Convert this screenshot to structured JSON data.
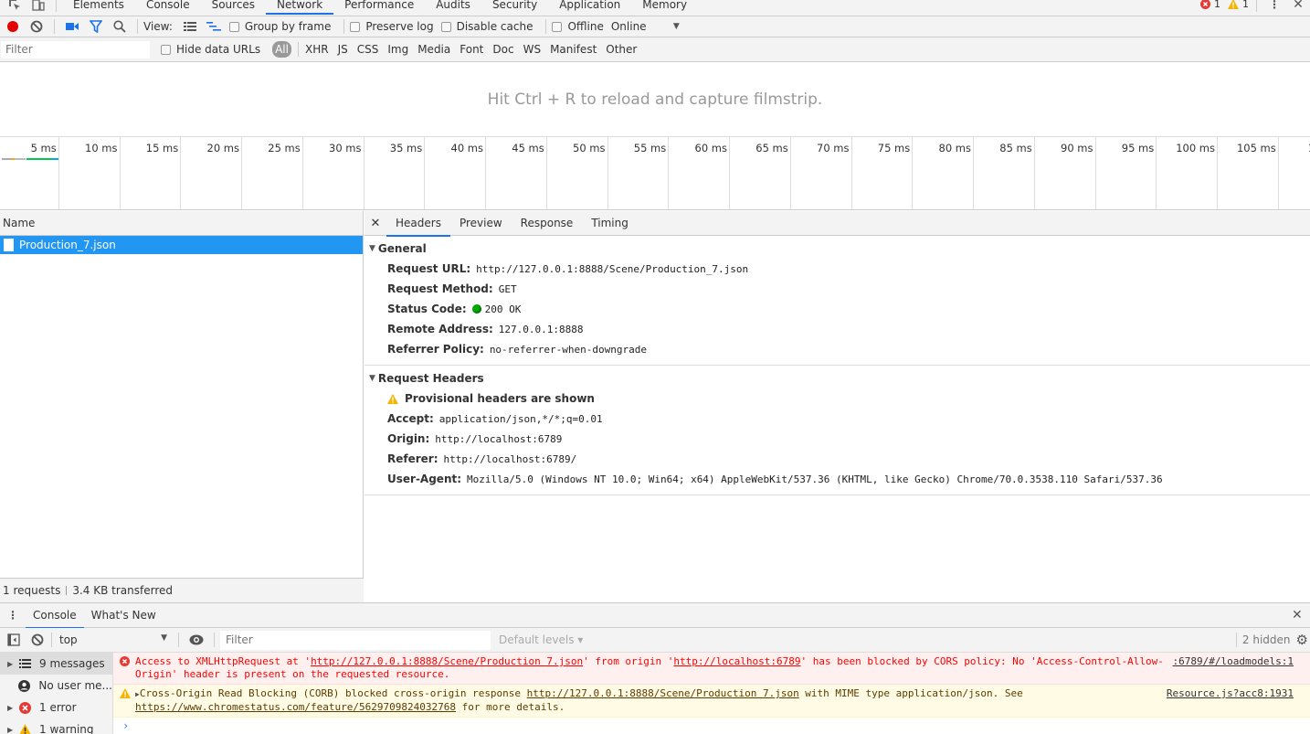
{
  "devtools_tabs": [
    "Elements",
    "Console",
    "Sources",
    "Network",
    "Performance",
    "Audits",
    "Security",
    "Application",
    "Memory"
  ],
  "active_tab": "Network",
  "tab_counts": {
    "errors": "1",
    "warnings": "1"
  },
  "toolbar": {
    "view_label": "View:",
    "group_by_frame": "Group by frame",
    "preserve_log": "Preserve log",
    "disable_cache": "Disable cache",
    "offline": "Offline",
    "throttling": "Online"
  },
  "filterbar": {
    "filter_placeholder": "Filter",
    "hide_data_urls": "Hide data URLs",
    "types": [
      "All",
      "XHR",
      "JS",
      "CSS",
      "Img",
      "Media",
      "Font",
      "Doc",
      "WS",
      "Manifest",
      "Other"
    ]
  },
  "filmstrip_hint": "Hit Ctrl + R to reload and capture filmstrip.",
  "timeline_ticks": [
    "5 ms",
    "10 ms",
    "15 ms",
    "20 ms",
    "25 ms",
    "30 ms",
    "35 ms",
    "40 ms",
    "45 ms",
    "50 ms",
    "55 ms",
    "60 ms",
    "65 ms",
    "70 ms",
    "75 ms",
    "80 ms",
    "85 ms",
    "90 ms",
    "95 ms",
    "100 ms",
    "105 ms",
    "1"
  ],
  "requests": {
    "header": "Name",
    "items": [
      {
        "name": "Production_7.json"
      }
    ],
    "summary_requests": "1 requests",
    "summary_transferred": "3.4 KB transferred"
  },
  "detail_tabs": [
    "Headers",
    "Preview",
    "Response",
    "Timing"
  ],
  "active_detail_tab": "Headers",
  "general": {
    "title": "General",
    "rows": [
      {
        "key": "Request URL:",
        "value": "http://127.0.0.1:8888/Scene/Production_7.json"
      },
      {
        "key": "Request Method:",
        "value": "GET"
      },
      {
        "key": "Status Code:",
        "value": "200 OK"
      },
      {
        "key": "Remote Address:",
        "value": "127.0.0.1:8888"
      },
      {
        "key": "Referrer Policy:",
        "value": "no-referrer-when-downgrade"
      }
    ]
  },
  "request_headers": {
    "title": "Request Headers",
    "provisional": "Provisional headers are shown",
    "rows": [
      {
        "key": "Accept:",
        "value": "application/json,*/*;q=0.01"
      },
      {
        "key": "Origin:",
        "value": "http://localhost:6789"
      },
      {
        "key": "Referer:",
        "value": "http://localhost:6789/"
      },
      {
        "key": "User-Agent:",
        "value": "Mozilla/5.0 (Windows NT 10.0; Win64; x64) AppleWebKit/537.36 (KHTML, like Gecko) Chrome/70.0.3538.110 Safari/537.36"
      }
    ]
  },
  "drawer_tabs": [
    "Console",
    "What's New"
  ],
  "console_toolbar": {
    "context": "top",
    "filter_placeholder": "Filter",
    "levels": "Default levels ▾",
    "hidden": "2 hidden"
  },
  "console_sidebar": [
    {
      "label": "9 messages",
      "icon": "list-icon"
    },
    {
      "label": "No user me...",
      "icon": "user-icon"
    },
    {
      "label": "1 error",
      "icon": "error-icon"
    },
    {
      "label": "1 warning",
      "icon": "warning-icon"
    }
  ],
  "console_messages": {
    "error": {
      "p1": "Access to XMLHttpRequest at '",
      "link1": "http://127.0.0.1:8888/Scene/Production 7.json",
      "p2": "' from origin '",
      "link2": "http://localhost:6789",
      "p3": "' has been blocked by CORS policy: No 'Access-Control-Allow-Origin' header is present on the requested resource.",
      "source": ":6789/#/loadmodels:1"
    },
    "warning": {
      "p1": "Cross-Origin Read Blocking (CORB) blocked cross-origin response ",
      "link1": "http://127.0.0.1:8888/Scene/Production 7.json",
      "p2": " with MIME type application/json. See ",
      "link2": "https://www.chromestatus.com/feature/5629709824032768",
      "p3": " for more details.",
      "source": "Resource.js?acc8:1931"
    }
  },
  "colors": {
    "accent": "#1a73e8",
    "selected_row": "#2196f3",
    "record": "#e50000",
    "status_ok": "#00aa00"
  }
}
